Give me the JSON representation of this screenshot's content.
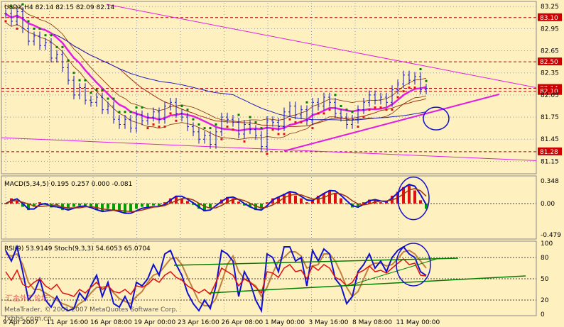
{
  "colors": {
    "background": "#FFF0C0",
    "axis_panel": "#FFF0C0",
    "price": "#1010D0",
    "ma_magenta": "#E020E0",
    "ma_blue": "#2020C0",
    "ma_brown": "#A03010",
    "envelope": "#803000",
    "sar_green": "#008000",
    "sar_red": "#E01010",
    "macd_pos": "#E01010",
    "macd_neg": "#00A000",
    "macd_signal": "#A03010",
    "rsi": "#E01010",
    "stoch_main": "#1010D0",
    "stoch_signal": "#C08040",
    "trend_green": "#008000",
    "dotted": "#404040",
    "red_level": "#B00000",
    "label_red": "#CC0000"
  },
  "chart_data": [
    {
      "panel": "main",
      "type": "candlestick",
      "title": "USDX,H4  82.14 82.15 82.09 82.14",
      "ylim": [
        81.0,
        83.3
      ],
      "y_ticks": [
        "83.25",
        "82.95",
        "82.65",
        "82.35",
        "82.05",
        "81.75",
        "81.45",
        "81.15"
      ],
      "highlight_labels": [
        {
          "text": "83.10",
          "value": 83.1
        },
        {
          "text": "82.50",
          "value": 82.5
        },
        {
          "text": "82.14",
          "value": 82.14
        },
        {
          "text": "82.10",
          "value": 82.1
        },
        {
          "text": "81.28",
          "value": 81.28
        }
      ],
      "close_path": [
        83.15,
        83.05,
        83.18,
        82.95,
        82.78,
        82.85,
        82.72,
        82.76,
        82.55,
        82.6,
        82.42,
        82.25,
        82.05,
        82.15,
        81.98,
        81.95,
        82.02,
        81.85,
        81.9,
        81.72,
        81.65,
        81.72,
        81.6,
        81.78,
        81.7,
        81.75,
        81.82,
        81.72,
        81.9,
        81.95,
        81.8,
        81.75,
        81.62,
        81.55,
        81.45,
        81.5,
        81.38,
        81.55,
        81.75,
        81.72,
        81.68,
        81.52,
        81.65,
        81.58,
        81.5,
        81.35,
        81.7,
        81.68,
        81.62,
        81.82,
        81.9,
        81.78,
        81.85,
        81.7,
        81.95,
        81.9,
        82.02,
        81.95,
        81.8,
        81.75,
        81.65,
        81.72,
        81.85,
        81.95,
        82.05,
        81.98,
        82.02,
        81.95,
        82.12,
        82.2,
        82.32,
        82.25,
        82.3,
        82.12,
        82.14
      ]
    },
    {
      "panel": "macd",
      "type": "histogram",
      "title": "MACD(5,34,5) 0.195 0.257 0.000 -0.081",
      "ylim": [
        -0.52,
        0.4
      ],
      "y_ticks": [
        "0.348",
        "0.00",
        "-0.479"
      ],
      "values": [
        0.0,
        0.08,
        0.05,
        -0.05,
        -0.1,
        -0.05,
        0.02,
        -0.02,
        -0.06,
        -0.03,
        -0.1,
        -0.08,
        -0.05,
        -0.03,
        -0.04,
        -0.07,
        -0.1,
        -0.12,
        -0.08,
        -0.1,
        -0.12,
        -0.15,
        -0.12,
        -0.08,
        -0.05,
        -0.06,
        -0.03,
        -0.05,
        0.02,
        0.08,
        0.12,
        0.08,
        0.04,
        -0.02,
        -0.08,
        -0.12,
        -0.06,
        0.0,
        0.06,
        0.1,
        0.08,
        0.03,
        -0.03,
        -0.06,
        -0.1,
        -0.08,
        0.02,
        0.08,
        0.1,
        0.15,
        0.18,
        0.12,
        0.08,
        0.02,
        0.06,
        0.12,
        0.16,
        0.2,
        0.15,
        0.08,
        0.0,
        -0.06,
        -0.04,
        0.02,
        0.06,
        0.05,
        0.02,
        0.03,
        0.12,
        0.18,
        0.25,
        0.28,
        0.2,
        0.05,
        -0.081
      ]
    },
    {
      "panel": "oscillators",
      "type": "line",
      "title": "RSI(9) 53.9149  Stoch(9,3,3) 54.6053 65.0704",
      "ylim": [
        0,
        100
      ],
      "y_ticks": [
        "100",
        "80",
        "50",
        "20",
        "0"
      ],
      "rsi": [
        60,
        48,
        62,
        42,
        38,
        45,
        50,
        40,
        35,
        42,
        30,
        28,
        25,
        35,
        30,
        38,
        45,
        35,
        40,
        32,
        30,
        35,
        28,
        40,
        38,
        42,
        50,
        45,
        55,
        60,
        52,
        48,
        40,
        35,
        30,
        35,
        28,
        45,
        65,
        60,
        55,
        40,
        50,
        45,
        38,
        30,
        60,
        58,
        52,
        65,
        70,
        60,
        62,
        50,
        68,
        62,
        70,
        65,
        52,
        48,
        40,
        45,
        58,
        62,
        68,
        60,
        62,
        58,
        65,
        72,
        78,
        70,
        72,
        55,
        53.9
      ],
      "stoch_main": [
        90,
        75,
        95,
        60,
        20,
        30,
        50,
        20,
        10,
        25,
        10,
        5,
        8,
        30,
        20,
        40,
        55,
        25,
        45,
        15,
        10,
        25,
        8,
        45,
        40,
        50,
        70,
        55,
        85,
        90,
        70,
        55,
        30,
        15,
        5,
        20,
        8,
        40,
        90,
        85,
        75,
        25,
        60,
        45,
        20,
        5,
        85,
        80,
        60,
        95,
        95,
        75,
        80,
        40,
        90,
        75,
        92,
        85,
        50,
        40,
        15,
        25,
        60,
        70,
        85,
        65,
        75,
        60,
        80,
        90,
        95,
        85,
        80,
        60,
        54.6
      ],
      "stoch_signal": [
        85,
        82,
        85,
        70,
        45,
        35,
        35,
        30,
        25,
        20,
        15,
        12,
        8,
        15,
        20,
        30,
        38,
        38,
        40,
        30,
        22,
        18,
        15,
        25,
        32,
        45,
        55,
        58,
        68,
        78,
        80,
        70,
        52,
        35,
        18,
        12,
        12,
        22,
        45,
        70,
        82,
        60,
        50,
        45,
        40,
        25,
        38,
        58,
        75,
        80,
        88,
        88,
        82,
        65,
        68,
        70,
        85,
        85,
        75,
        58,
        38,
        25,
        32,
        50,
        68,
        72,
        72,
        68,
        70,
        78,
        88,
        90,
        85,
        75,
        65.07
      ]
    }
  ],
  "x_axis_labels": [
    "9 Apr 2007",
    "11 Apr 16:00",
    "16 Apr 08:00",
    "19 Apr 00:00",
    "23 Apr 16:00",
    "26 Apr 08:00",
    "1 May 00:00",
    "3 May 16:00",
    "8 May 08:00",
    "11 May 00:00"
  ],
  "watermarks": [
    "MetaTrader, © 2001-2007 MetaQuotes Software Corp.",
    "汇金外汇论坛",
    "fxbbs.com.cn"
  ]
}
